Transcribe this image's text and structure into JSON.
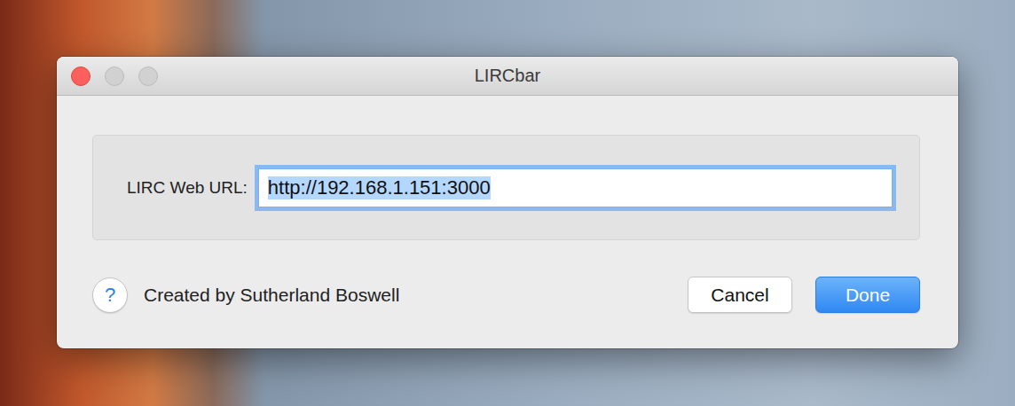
{
  "window": {
    "title": "LIRCbar"
  },
  "form": {
    "label": "LIRC Web URL:",
    "value": "http://192.168.1.151:3000",
    "focused": true,
    "value_selected": true
  },
  "help": {
    "symbol": "?"
  },
  "credit": "Created by Sutherland Boswell",
  "buttons": [
    {
      "label": "Cancel",
      "default": false
    },
    {
      "label": "Done",
      "default": true
    }
  ]
}
